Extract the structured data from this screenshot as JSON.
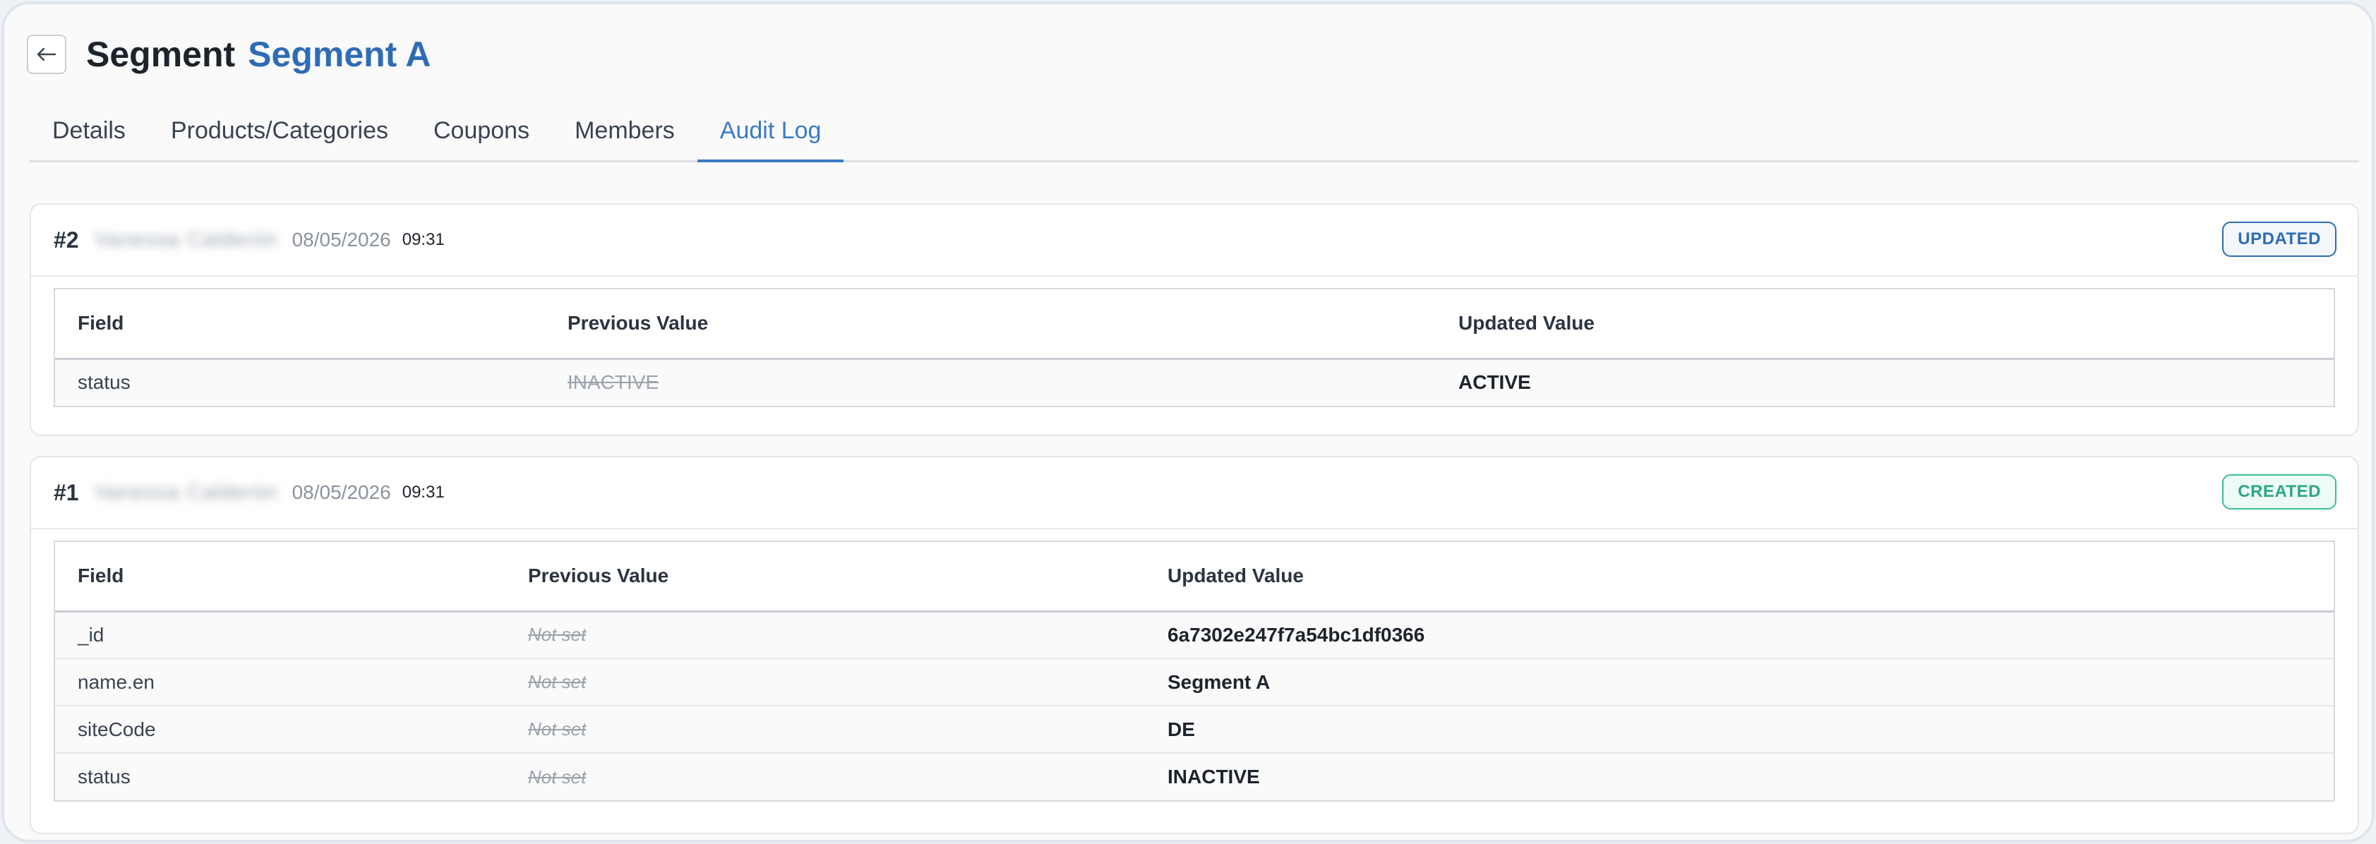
{
  "header": {
    "title_label": "Segment",
    "segment_name": "Segment A",
    "back_icon": "arrow-left-icon"
  },
  "tabs": [
    {
      "label": "Details"
    },
    {
      "label": "Products/Categories"
    },
    {
      "label": "Coupons"
    },
    {
      "label": "Members"
    },
    {
      "label": "Audit Log",
      "active": true
    }
  ],
  "columns": {
    "field": "Field",
    "previous": "Previous Value",
    "updated": "Updated Value"
  },
  "entries": [
    {
      "number": "#2",
      "author": "Vanessa Calderón",
      "date": "08/05/2026",
      "time": "09:31",
      "action": "UPDATED",
      "action_color": "#2f6cb5",
      "rows": [
        {
          "field": "status",
          "previous": "INACTIVE",
          "updated": "ACTIVE"
        }
      ]
    },
    {
      "number": "#1",
      "author": "Vanessa Calderón",
      "date": "08/05/2026",
      "time": "09:31",
      "action": "CREATED",
      "action_color": "#2aa884",
      "rows": [
        {
          "field": "_id",
          "previous": "Not set",
          "updated": "6a7302e247f7a54bc1df0366"
        },
        {
          "field": "name.en",
          "previous": "Not set",
          "updated": "Segment A"
        },
        {
          "field": "siteCode",
          "previous": "Not set",
          "updated": "DE"
        },
        {
          "field": "status",
          "previous": "Not set",
          "updated": "INACTIVE"
        }
      ]
    }
  ]
}
